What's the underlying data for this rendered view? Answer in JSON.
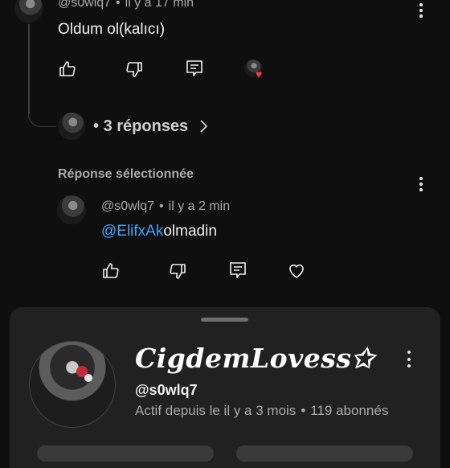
{
  "top_comment": {
    "author": "@s0wlq7",
    "time": "il y a 17 min",
    "text": "Oldum ol(kalıcı)"
  },
  "replies_link": {
    "label": "3 réponses",
    "dot": "•"
  },
  "selected_section": {
    "heading": "Réponse sélectionnée"
  },
  "reply_comment": {
    "author": "@s0wlq7",
    "time": "il y a 2 min",
    "mention": "@ElifxAk",
    "text": "olmadin"
  },
  "separator": "•",
  "channel_sheet": {
    "name": "CigdemLovess✩",
    "handle": "@s0wlq7",
    "active": "Actif depuis le il y a 3 mois",
    "subscribers": "119 abonnés"
  },
  "colors": {
    "background": "#0f0f0f",
    "sheet": "#212121",
    "mention": "#3ea6ff",
    "heart_badge": "#ff3250"
  },
  "icons": [
    "like-icon",
    "dislike-icon",
    "reply-icon",
    "heart-icon",
    "kebab-icon",
    "chevron-right-icon"
  ]
}
